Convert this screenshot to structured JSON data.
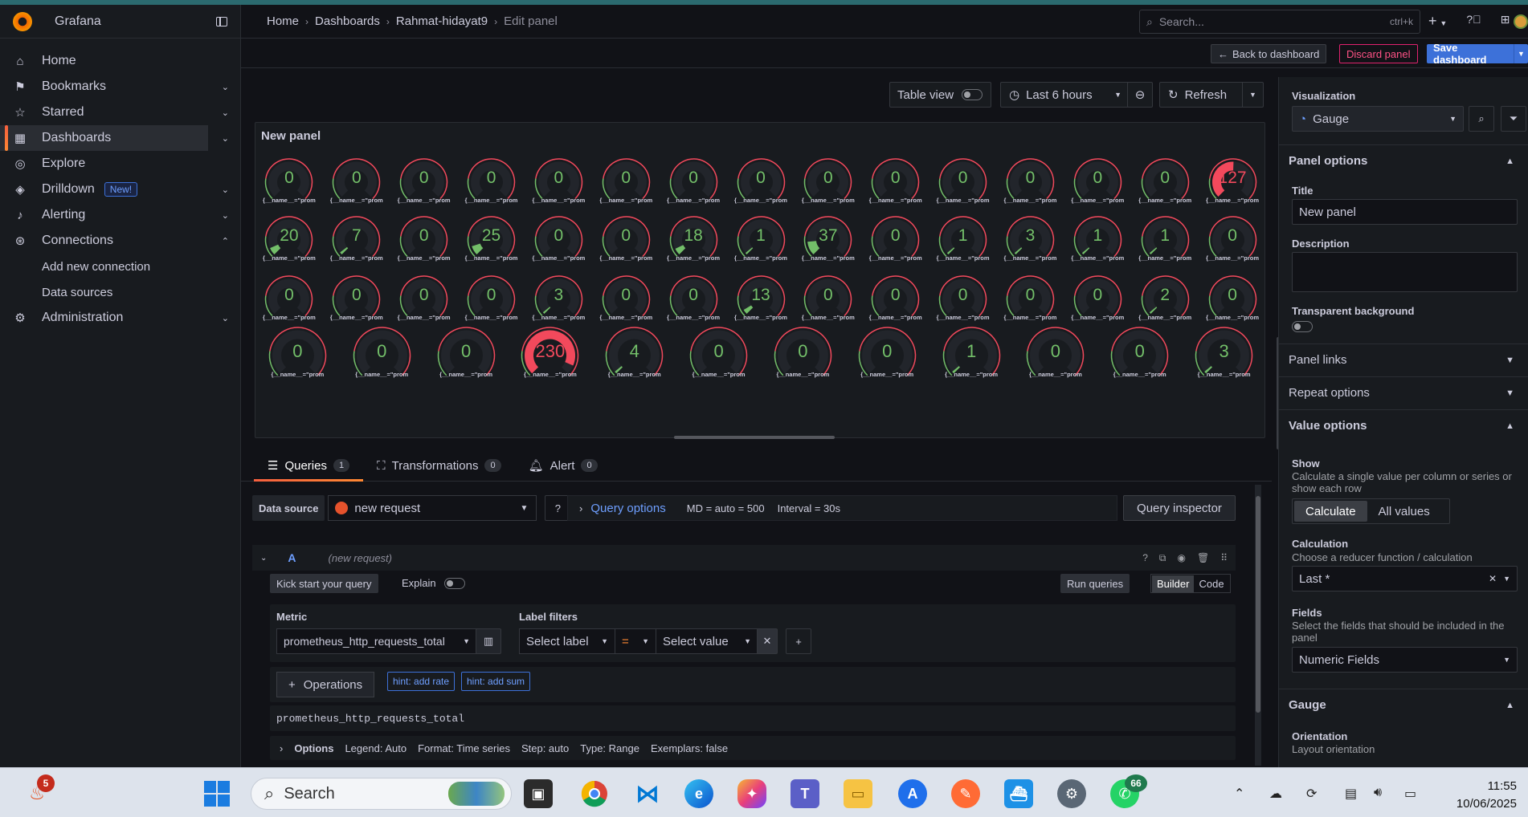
{
  "app": {
    "name": "Grafana"
  },
  "sidebar": {
    "items": [
      {
        "label": "Home",
        "icon": "home-icon"
      },
      {
        "label": "Bookmarks",
        "icon": "bookmark-icon"
      },
      {
        "label": "Starred",
        "icon": "star-icon"
      },
      {
        "label": "Dashboards",
        "icon": "dashboards-icon"
      },
      {
        "label": "Explore",
        "icon": "compass-icon"
      },
      {
        "label": "Drilldown",
        "icon": "drilldown-icon",
        "badge": "New!"
      },
      {
        "label": "Alerting",
        "icon": "bell-icon"
      },
      {
        "label": "Connections",
        "icon": "connections-icon"
      },
      {
        "label": "Add new connection"
      },
      {
        "label": "Data sources"
      },
      {
        "label": "Administration",
        "icon": "gear-icon"
      }
    ]
  },
  "breadcrumb": [
    "Home",
    "Dashboards",
    "Rahmat-hidayat9",
    "Edit panel"
  ],
  "topbar": {
    "search_placeholder": "Search...",
    "search_shortcut": "ctrl+k",
    "plus": "+"
  },
  "actions": {
    "back": "Back to dashboard",
    "discard": "Discard panel",
    "save": "Save dashboard"
  },
  "panel_toolbar": {
    "table_view": "Table view",
    "time_range": "Last 6 hours",
    "refresh": "Refresh"
  },
  "panel": {
    "title": "New panel",
    "gauge_label": "{__name__=\"prom",
    "rows": [
      [
        0,
        0,
        0,
        0,
        0,
        0,
        0,
        0,
        0,
        0,
        0,
        0,
        0,
        0,
        127
      ],
      [
        20,
        7,
        0,
        25,
        0,
        0,
        18,
        1,
        37,
        0,
        1,
        3,
        1,
        1,
        0
      ],
      [
        0,
        0,
        0,
        0,
        3,
        0,
        0,
        13,
        0,
        0,
        0,
        0,
        0,
        2,
        0
      ],
      [
        0,
        0,
        0,
        230,
        4,
        0,
        0,
        0,
        1,
        0,
        0,
        3
      ]
    ],
    "max": 250,
    "threshold_color": "#f2495c",
    "base_color": "#73bf69"
  },
  "query_tabs": [
    {
      "label": "Queries",
      "count": "1"
    },
    {
      "label": "Transformations",
      "count": "0"
    },
    {
      "label": "Alert",
      "count": "0"
    }
  ],
  "query": {
    "datasource_label": "Data source",
    "datasource": "new request",
    "options_link": "Query options",
    "md": "MD = auto = 500",
    "interval": "Interval = 30s",
    "inspector": "Query inspector",
    "row_id": "A",
    "row_name": "(new request)",
    "kickstart": "Kick start your query",
    "explain": "Explain",
    "run": "Run queries",
    "builder": "Builder",
    "code": "Code",
    "metric_label": "Metric",
    "metric": "prometheus_http_requests_total",
    "label_filters": "Label filters",
    "select_label": "Select label",
    "op": "=",
    "select_value": "Select value",
    "operations": "Operations",
    "hints": [
      "hint: add rate",
      "hint: add sum"
    ],
    "preview": "prometheus_http_requests_total",
    "options": "Options",
    "legend": "Legend: Auto",
    "format": "Format: Time series",
    "step": "Step: auto",
    "type": "Type: Range",
    "exemplars": "Exemplars: false"
  },
  "options_pane": {
    "visualization_label": "Visualization",
    "visualization": "Gauge",
    "panel_options": "Panel options",
    "title_label": "Title",
    "title_value": "New panel",
    "description_label": "Description",
    "transparent_label": "Transparent background",
    "panel_links": "Panel links",
    "repeat_options": "Repeat options",
    "value_options": "Value options",
    "show_label": "Show",
    "show_desc": "Calculate a single value per column or series or show each row",
    "calculate": "Calculate",
    "all_values": "All values",
    "calculation_label": "Calculation",
    "calculation_desc": "Choose a reducer function / calculation",
    "calculation_value": "Last *",
    "fields_label": "Fields",
    "fields_desc": "Select the fields that should be included in the panel",
    "fields_value": "Numeric Fields",
    "gauge_section": "Gauge",
    "orientation_label": "Orientation",
    "orientation_desc": "Layout orientation"
  },
  "taskbar": {
    "search": "Search",
    "notif_left": "5",
    "notif_whatsapp": "66",
    "time": "11:55",
    "date": "10/06/2025"
  }
}
